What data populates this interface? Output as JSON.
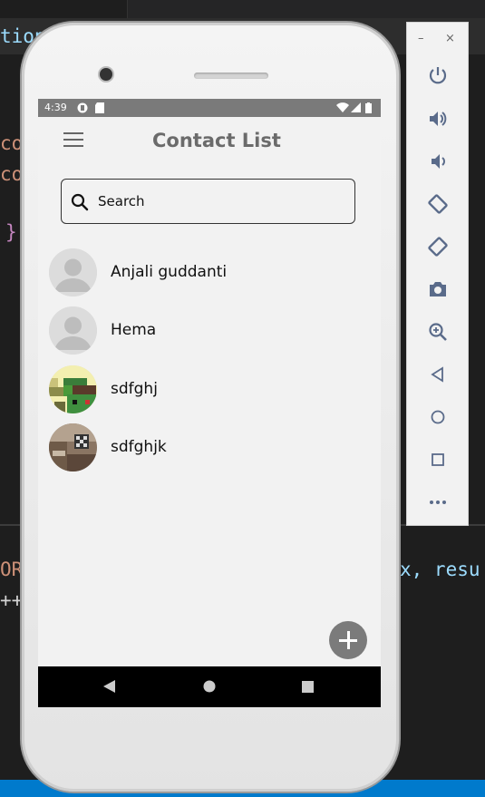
{
  "editor": {
    "lines": [
      {
        "text": "tion()",
        "color": "#9cdcfe"
      },
      {
        "text": "co",
        "color": "#ce9178"
      },
      {
        "text": "co",
        "color": "#ce9178"
      },
      {
        "text": "}",
        "color": "#c586c0"
      },
      {
        "text": "ORI",
        "color": "#ce9178"
      },
      {
        "text": "++",
        "color": "#d4d4d4"
      },
      {
        "text": "x, resu",
        "color": "#9cdcfe"
      }
    ]
  },
  "statusbar": {
    "time": "4:39"
  },
  "appbar": {
    "title": "Contact List"
  },
  "search": {
    "placeholder": "Search",
    "value": ""
  },
  "contacts": [
    {
      "name": "Anjali guddanti",
      "avatar": "default-avatar"
    },
    {
      "name": "Hema",
      "avatar": "default-avatar"
    },
    {
      "name": "sdfghj",
      "avatar": "pixel-art-photo"
    },
    {
      "name": "sdfghjk",
      "avatar": "room-photo"
    }
  ],
  "emulator_toolbar": {
    "buttons": [
      "power-icon",
      "volume-up-icon",
      "volume-down-icon",
      "rotate-left-icon",
      "rotate-right-icon",
      "camera-icon",
      "zoom-icon",
      "back-icon",
      "home-icon",
      "overview-icon",
      "more-icon"
    ],
    "minimize": "–",
    "close": "×"
  },
  "colors": {
    "accent": "#7b7b7b",
    "statusbar": "#7a7a7a",
    "toolbar_icons": "#5a6b8a"
  }
}
